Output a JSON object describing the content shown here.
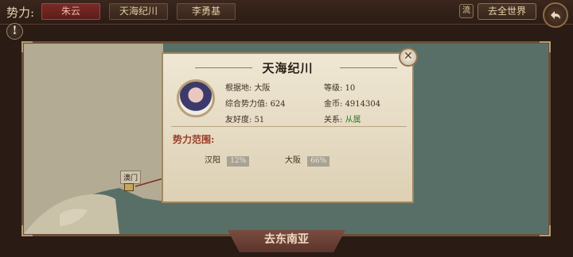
{
  "topbar": {
    "faction_label": "势力:",
    "tabs": [
      {
        "label": "朱云",
        "active": true
      },
      {
        "label": "天海纪川",
        "active": false
      },
      {
        "label": "李勇基",
        "active": false
      }
    ],
    "liu_label": "流",
    "world_button": "去全世界"
  },
  "map": {
    "city_label": "澳门"
  },
  "bottom_button": "去东南亚",
  "popup": {
    "title": "天海纪川",
    "base_label": "根据地:",
    "base_value": "大阪",
    "level_label": "等级:",
    "level_value": "10",
    "power_label": "综合势力值:",
    "power_value": "624",
    "gold_label": "金币:",
    "gold_value": "4914304",
    "friend_label": "友好度:",
    "friend_value": "51",
    "relation_label": "关系:",
    "relation_value": "从属",
    "range_title": "势力范围:",
    "ranges": [
      {
        "city": "汉阳",
        "percent": "12%"
      },
      {
        "city": "大阪",
        "percent": "66%"
      }
    ]
  },
  "colors": {
    "active_tab": "#7a2a26",
    "relation_green": "#2f7a2a",
    "range_title": "#9a3d2a"
  }
}
